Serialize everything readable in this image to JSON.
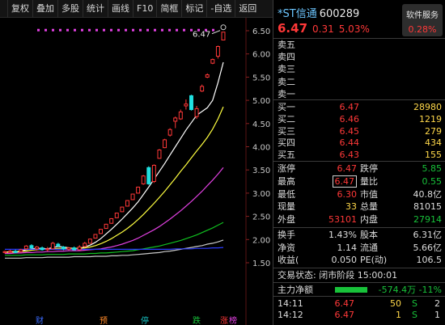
{
  "toolbar": {
    "buttons": [
      "复权",
      "叠加",
      "多股",
      "统计",
      "画线",
      "F10",
      "简框",
      "标记",
      "-自选",
      "返回"
    ]
  },
  "chart": {
    "y_labels": [
      "6.50",
      "6.00",
      "5.50",
      "5.00",
      "4.50",
      "4.00",
      "3.50",
      "3.00",
      "2.50",
      "2.00",
      "1.50"
    ],
    "price_tag": "6.47",
    "bottom_markers": [
      {
        "text": "财",
        "color": "#3a6cff"
      },
      {
        "text": "预",
        "color": "#ff8a2a"
      },
      {
        "text": "停",
        "color": "#18c8c8"
      },
      {
        "text": "跌",
        "color": "#18c23a"
      },
      {
        "text": "涨",
        "color": "#ff3838"
      },
      {
        "text": "榜",
        "color": "#e040e0"
      }
    ],
    "chart_data": {
      "type": "candlestick",
      "ylim": [
        1.5,
        6.55
      ],
      "candles": [
        {
          "o": 1.72,
          "c": 1.74,
          "h": 1.76,
          "l": 1.7,
          "up": true
        },
        {
          "o": 1.73,
          "c": 1.75,
          "h": 1.78,
          "l": 1.71,
          "up": true
        },
        {
          "o": 1.75,
          "c": 1.72,
          "h": 1.78,
          "l": 1.7,
          "up": false
        },
        {
          "o": 1.74,
          "c": 1.78,
          "h": 1.8,
          "l": 1.72,
          "up": true
        },
        {
          "o": 1.8,
          "c": 1.86,
          "h": 1.88,
          "l": 1.78,
          "up": true
        },
        {
          "o": 1.87,
          "c": 1.82,
          "h": 1.9,
          "l": 1.8,
          "up": false
        },
        {
          "o": 1.8,
          "c": 1.84,
          "h": 1.86,
          "l": 1.76,
          "up": true
        },
        {
          "o": 1.82,
          "c": 1.78,
          "h": 1.85,
          "l": 1.76,
          "up": false
        },
        {
          "o": 1.78,
          "c": 1.8,
          "h": 1.84,
          "l": 1.75,
          "up": true
        },
        {
          "o": 1.8,
          "c": 1.92,
          "h": 1.95,
          "l": 1.79,
          "up": true
        },
        {
          "o": 1.9,
          "c": 1.86,
          "h": 1.93,
          "l": 1.84,
          "up": false
        },
        {
          "o": 1.84,
          "c": 1.8,
          "h": 1.86,
          "l": 1.77,
          "up": false
        },
        {
          "o": 1.79,
          "c": 1.82,
          "h": 1.84,
          "l": 1.77,
          "up": true
        },
        {
          "o": 1.82,
          "c": 1.78,
          "h": 1.85,
          "l": 1.76,
          "up": false
        },
        {
          "o": 1.78,
          "c": 1.84,
          "h": 1.88,
          "l": 1.77,
          "up": true
        },
        {
          "o": 1.85,
          "c": 1.92,
          "h": 1.95,
          "l": 1.83,
          "up": true
        },
        {
          "o": 1.92,
          "c": 2.01,
          "h": 2.02,
          "l": 1.91,
          "up": true
        },
        {
          "o": 2.03,
          "c": 2.11,
          "h": 2.12,
          "l": 2.02,
          "up": true
        },
        {
          "o": 2.13,
          "c": 2.22,
          "h": 2.23,
          "l": 2.12,
          "up": true
        },
        {
          "o": 2.24,
          "c": 2.33,
          "h": 2.34,
          "l": 2.23,
          "up": true
        },
        {
          "o": 2.35,
          "c": 2.45,
          "h": 2.46,
          "l": 2.34,
          "up": true
        },
        {
          "o": 2.47,
          "c": 2.57,
          "h": 2.58,
          "l": 2.46,
          "up": true
        },
        {
          "o": 2.6,
          "c": 2.7,
          "h": 2.71,
          "l": 2.59,
          "up": true
        },
        {
          "o": 2.72,
          "c": 2.84,
          "h": 2.85,
          "l": 2.71,
          "up": true
        },
        {
          "o": 2.86,
          "c": 2.98,
          "h": 2.99,
          "l": 2.85,
          "up": true
        },
        {
          "o": 3.0,
          "c": 3.13,
          "h": 3.14,
          "l": 2.99,
          "up": true
        },
        {
          "o": 3.2,
          "c": 3.37,
          "h": 3.39,
          "l": 3.18,
          "up": true
        },
        {
          "o": 3.2,
          "c": 3.55,
          "h": 3.58,
          "l": 3.18,
          "up": false
        },
        {
          "o": 3.25,
          "c": 3.6,
          "h": 3.62,
          "l": 3.22,
          "up": true
        },
        {
          "o": 3.75,
          "c": 3.93,
          "h": 3.95,
          "l": 3.74,
          "up": true
        },
        {
          "o": 3.98,
          "c": 4.15,
          "h": 4.17,
          "l": 3.97,
          "up": true
        },
        {
          "o": 4.25,
          "c": 4.37,
          "h": 4.4,
          "l": 4.22,
          "up": true
        },
        {
          "o": 4.55,
          "c": 4.62,
          "h": 4.65,
          "l": 4.4,
          "up": true
        },
        {
          "o": 4.6,
          "c": 4.75,
          "h": 4.8,
          "l": 4.58,
          "up": true
        },
        {
          "o": 4.88,
          "c": 4.92,
          "h": 5.02,
          "l": 4.8,
          "up": true
        },
        {
          "o": 4.8,
          "c": 5.1,
          "h": 5.12,
          "l": 4.78,
          "up": false
        },
        {
          "o": 4.65,
          "c": 4.82,
          "h": 4.88,
          "l": 4.6,
          "up": true
        },
        {
          "o": 5.2,
          "c": 5.3,
          "h": 5.34,
          "l": 5.18,
          "up": true
        },
        {
          "o": 5.5,
          "c": 5.55,
          "h": 5.58,
          "l": 5.48,
          "up": true
        },
        {
          "o": 5.8,
          "c": 5.88,
          "h": 5.9,
          "l": 5.78,
          "up": true
        },
        {
          "o": 5.95,
          "c": 6.16,
          "h": 6.18,
          "l": 5.9,
          "up": true
        },
        {
          "o": 6.3,
          "c": 6.47,
          "h": 6.47,
          "l": 6.3,
          "up": true
        }
      ],
      "ma_series": [
        {
          "color": "#ffffff",
          "values": [
            1.73,
            1.74,
            1.74,
            1.75,
            1.78,
            1.8,
            1.81,
            1.81,
            1.8,
            1.83,
            1.85,
            1.84,
            1.82,
            1.81,
            1.81,
            1.84,
            1.88,
            1.94,
            2.02,
            2.12,
            2.22,
            2.33,
            2.44,
            2.56,
            2.68,
            2.81,
            2.97,
            3.13,
            3.3,
            3.47,
            3.64,
            3.82,
            4.0,
            4.18,
            4.36,
            4.52,
            4.68,
            4.76,
            4.84,
            5.0,
            5.38,
            5.82
          ]
        },
        {
          "color": "#ffff40",
          "values": [
            1.72,
            1.73,
            1.73,
            1.74,
            1.75,
            1.77,
            1.78,
            1.79,
            1.79,
            1.8,
            1.81,
            1.81,
            1.81,
            1.81,
            1.81,
            1.82,
            1.84,
            1.87,
            1.91,
            1.96,
            2.02,
            2.09,
            2.16,
            2.24,
            2.33,
            2.43,
            2.54,
            2.66,
            2.78,
            2.91,
            3.04,
            3.18,
            3.32,
            3.47,
            3.61,
            3.76,
            3.91,
            4.05,
            4.2,
            4.38,
            4.6,
            4.86
          ]
        },
        {
          "color": "#e040e0",
          "values": [
            1.7,
            1.7,
            1.71,
            1.71,
            1.72,
            1.72,
            1.73,
            1.73,
            1.74,
            1.74,
            1.75,
            1.75,
            1.76,
            1.76,
            1.76,
            1.77,
            1.78,
            1.79,
            1.8,
            1.82,
            1.84,
            1.87,
            1.9,
            1.94,
            1.98,
            2.03,
            2.09,
            2.15,
            2.21,
            2.28,
            2.36,
            2.44,
            2.53,
            2.62,
            2.72,
            2.82,
            2.93,
            3.04,
            3.16,
            3.28,
            3.41,
            3.55
          ]
        },
        {
          "color": "#10c020",
          "values": [
            1.66,
            1.66,
            1.66,
            1.66,
            1.67,
            1.67,
            1.67,
            1.67,
            1.68,
            1.68,
            1.68,
            1.68,
            1.69,
            1.69,
            1.69,
            1.69,
            1.7,
            1.7,
            1.71,
            1.71,
            1.72,
            1.73,
            1.74,
            1.75,
            1.76,
            1.78,
            1.8,
            1.82,
            1.84,
            1.86,
            1.89,
            1.92,
            1.95,
            1.98,
            2.02,
            2.06,
            2.1,
            2.15,
            2.2,
            2.25,
            2.31,
            2.37
          ]
        },
        {
          "color": "#c8c8c8",
          "values": [
            1.6,
            1.6,
            1.6,
            1.6,
            1.61,
            1.61,
            1.61,
            1.61,
            1.62,
            1.62,
            1.62,
            1.62,
            1.62,
            1.63,
            1.63,
            1.63,
            1.63,
            1.64,
            1.64,
            1.64,
            1.65,
            1.65,
            1.66,
            1.66,
            1.67,
            1.68,
            1.69,
            1.7,
            1.71,
            1.72,
            1.74,
            1.75,
            1.77,
            1.79,
            1.81,
            1.83,
            1.85,
            1.87,
            1.9,
            1.92,
            1.95,
            1.99
          ]
        },
        {
          "color": "#2a3aff",
          "values": [
            1.79,
            1.79,
            1.79,
            1.79,
            1.79,
            1.79,
            1.79,
            1.79,
            1.79,
            1.79,
            1.79,
            1.79,
            1.79,
            1.79,
            1.79,
            1.79,
            1.79,
            1.79,
            1.79,
            1.79,
            1.79,
            1.79,
            1.79,
            1.79,
            1.79,
            1.79,
            1.79,
            1.79,
            1.79,
            1.79,
            1.79,
            1.79,
            1.8,
            1.8,
            1.8,
            1.8,
            1.81,
            1.81,
            1.81,
            1.82,
            1.82,
            1.83
          ]
        }
      ]
    }
  },
  "quote": {
    "name": "*ST信通",
    "code": "600289",
    "price": "6.47",
    "change": "0.31",
    "pct": "5.03%",
    "sector_label": "软件服务",
    "sector_pct": "0.28%"
  },
  "asks": [
    {
      "label": "卖五"
    },
    {
      "label": "卖四"
    },
    {
      "label": "卖三"
    },
    {
      "label": "卖二"
    },
    {
      "label": "卖一"
    }
  ],
  "bids": [
    {
      "label": "买一",
      "price": "6.47",
      "vol": "28980"
    },
    {
      "label": "买二",
      "price": "6.46",
      "vol": "1219"
    },
    {
      "label": "买三",
      "price": "6.45",
      "vol": "279"
    },
    {
      "label": "买四",
      "price": "6.44",
      "vol": "434"
    },
    {
      "label": "买五",
      "price": "6.43",
      "vol": "155"
    }
  ],
  "stats": [
    {
      "l1": "涨停",
      "v1": "6.47",
      "l2": "跌停",
      "v2": "5.85",
      "v2color": "#18c23a"
    },
    {
      "l1": "最高",
      "v1": "6.47",
      "l2": "量比",
      "v2": "0.55",
      "v2color": "#18c23a"
    },
    {
      "l1": "最低",
      "v1": "6.30",
      "l2": "市值",
      "v2": "40.8亿",
      "v2color": "#dcdcdc"
    },
    {
      "l1": "现量",
      "v1": "33",
      "l2": "总量",
      "v2": "81015",
      "v2color": "#dcdcdc"
    },
    {
      "l1": "外盘",
      "v1": "53101",
      "l2": "内盘",
      "v2": "27914",
      "v2color": "#18c23a"
    }
  ],
  "stats2": [
    {
      "l1": "换手",
      "v1": "1.43%",
      "l2": "股本",
      "v2": "6.31亿"
    },
    {
      "l1": "净资",
      "v1": "1.14",
      "l2": "流通",
      "v2": "5.66亿"
    },
    {
      "l1": "收益(",
      "v1": "0.050",
      "l2": "PE(动)",
      "v2": "106.5"
    }
  ],
  "trade_status": "交易状态: 闭市阶段 15:00:01",
  "netflow": {
    "label": "主力净额",
    "value": "-574.4万 -11%"
  },
  "ticks": [
    {
      "time": "14:11",
      "price": "6.47",
      "vol": "50",
      "side": "S",
      "count": "2"
    },
    {
      "time": "14:12",
      "price": "6.47",
      "vol": "1",
      "side": "S",
      "count": "1"
    }
  ]
}
